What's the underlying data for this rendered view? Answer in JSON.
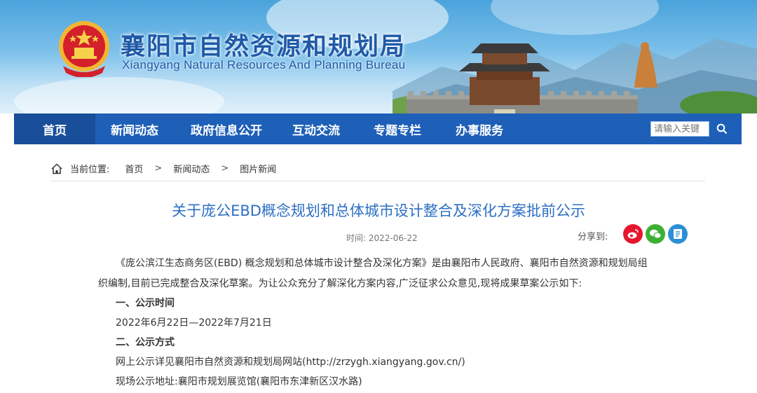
{
  "header": {
    "title": "襄阳市自然资源和规划局",
    "subtitle": "Xiangyang Natural Resources And Planning Bureau",
    "emblem_icon": "national-emblem-icon"
  },
  "nav": {
    "items": [
      {
        "label": "首页",
        "active": true
      },
      {
        "label": "新闻动态"
      },
      {
        "label": "政府信息公开"
      },
      {
        "label": "互动交流"
      },
      {
        "label": "专题专栏"
      },
      {
        "label": "办事服务"
      }
    ],
    "search_placeholder": "请输入关键",
    "search_icon": "search-icon",
    "colors": {
      "bar": "#1e5fb8",
      "active": "#184e9a"
    }
  },
  "breadcrumb": {
    "prefix": "当前位置:",
    "items": [
      "首页",
      "新闻动态",
      "图片新闻"
    ],
    "separator": ">"
  },
  "article": {
    "title": "关于庞公EBD概念规划和总体城市设计整合及深化方案批前公示",
    "time": "时间: 2022-06-22",
    "share_label": "分享到:",
    "share_icons": [
      "weibo-icon",
      "wechat-icon",
      "qzone-icon"
    ],
    "para1_line1": "《庞公滨江生态商务区(EBD) 概念规划和总体城市设计整合及深化方案》是由襄阳市人民政府、襄阳市自然资源和规划局组",
    "para1_line2": "织编制,目前已完成整合及深化草案。为让公众充分了解深化方案内容,广泛征求公众意见,现将成果草案公示如下:",
    "section1": "一、公示时间",
    "section1_text": "2022年6月22日—2022年7月21日",
    "section2": "二、公示方式",
    "section2_line1": "网上公示详见襄阳市自然资源和规划局网站(http://zrzygh.xiangyang.gov.cn/)",
    "section2_line2": "现场公示地址:襄阳市规划展览馆(襄阳市东津新区汉水路)"
  }
}
